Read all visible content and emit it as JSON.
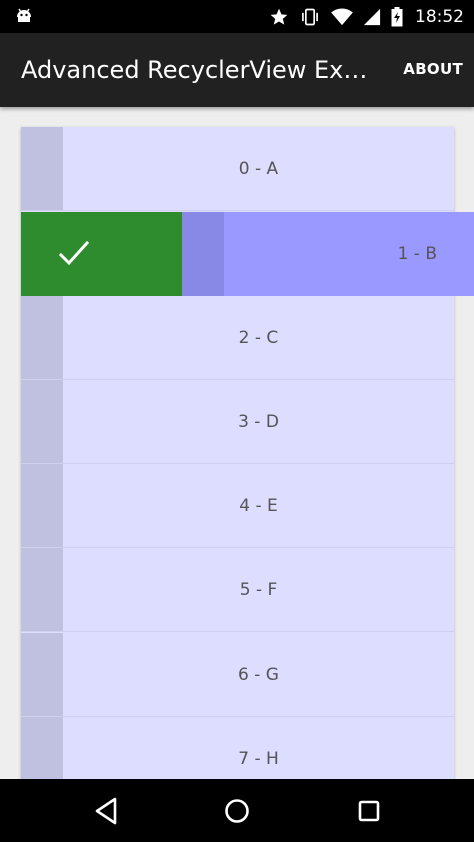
{
  "status_bar": {
    "time": "18:52",
    "icons": [
      "android-debug-icon",
      "star-icon",
      "vibrate-icon",
      "wifi-icon",
      "signal-icon",
      "battery-charging-icon"
    ]
  },
  "toolbar": {
    "title": "Advanced RecyclerView Exa…",
    "action_label": "ABOUT"
  },
  "list": {
    "items": [
      {
        "label": "0 - A"
      },
      {
        "label": "1 - B"
      },
      {
        "label": "2 - C"
      },
      {
        "label": "3 - D"
      },
      {
        "label": "4 - E"
      },
      {
        "label": "5 - F"
      },
      {
        "label": "6 - G"
      },
      {
        "label": "7 - H"
      }
    ],
    "swiped_item_index": 1,
    "swipe_action_icon": "check-icon"
  },
  "colors": {
    "item_bg": "#DDDDFF",
    "handle_bg": "#C0C1E0",
    "swiped_item_bg": "#9999FF",
    "swipe_action_bg": "#2E8B2E",
    "toolbar_bg": "#212121"
  },
  "nav_bar": {
    "icons": [
      "back-icon",
      "home-icon",
      "recents-icon"
    ]
  }
}
